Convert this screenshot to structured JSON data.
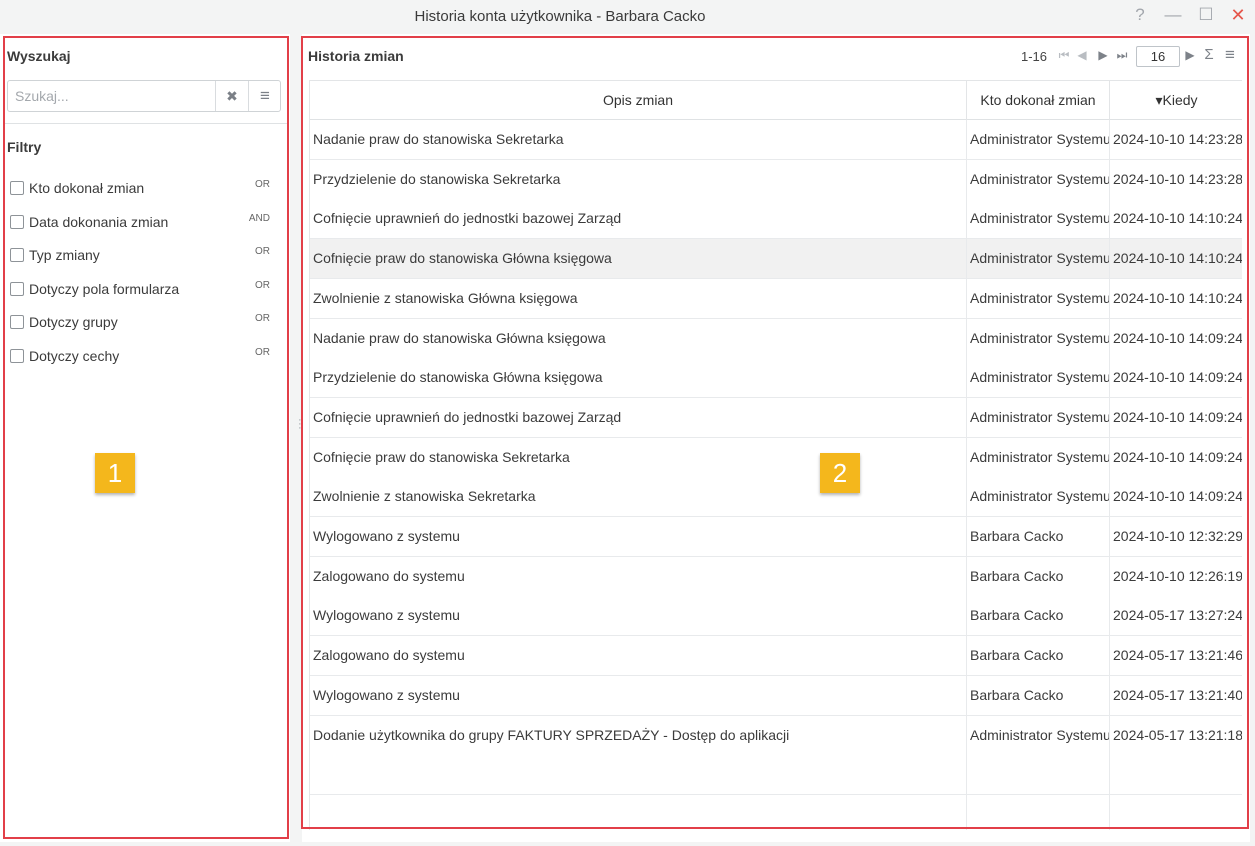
{
  "window": {
    "title": "Historia konta użytkownika - Barbara Cacko",
    "help": "?",
    "minimize": "—",
    "maximize": "☐",
    "close": "✕"
  },
  "left": {
    "search_label": "Wyszukaj",
    "search_placeholder": "Szukaj...",
    "clear_icon": "✖",
    "menu_icon": "≡",
    "filters_label": "Filtry",
    "filters": [
      {
        "label": "Kto dokonał zmian",
        "op": "OR"
      },
      {
        "label": "Data dokonania zmian",
        "op": "AND"
      },
      {
        "label": "Typ zmiany",
        "op": "OR"
      },
      {
        "label": "Dotyczy pola formularza",
        "op": "OR"
      },
      {
        "label": "Dotyczy grupy",
        "op": "OR"
      },
      {
        "label": "Dotyczy cechy",
        "op": "OR"
      }
    ],
    "badge": "1"
  },
  "right": {
    "title": "Historia zmian",
    "range": "1-16",
    "page_size": "16",
    "icons": {
      "first": "⏮",
      "prev": "◀",
      "next": "▶",
      "last": "⏭",
      "next2": "▶",
      "sum": "Σ",
      "menu": "≡"
    },
    "badge": "2",
    "columns": [
      "Opis zmian",
      "Kto dokonał zmian",
      "▾Kiedy"
    ],
    "rows": [
      [
        "Nadanie praw do stanowiska Sekretarka",
        "Administrator Systemu",
        "2024-10-10 14:23:28"
      ],
      [
        "Przydzielenie do stanowiska Sekretarka",
        "Administrator Systemu",
        "2024-10-10 14:23:28"
      ],
      [
        "Cofnięcie uprawnień do jednostki bazowej Zarząd",
        "Administrator Systemu",
        "2024-10-10 14:10:24"
      ],
      [
        "Cofnięcie praw do stanowiska Główna księgowa",
        "Administrator Systemu",
        "2024-10-10 14:10:24"
      ],
      [
        "Zwolnienie z stanowiska Główna księgowa",
        "Administrator Systemu",
        "2024-10-10 14:10:24"
      ],
      [
        "Nadanie praw do stanowiska Główna księgowa",
        "Administrator Systemu",
        "2024-10-10 14:09:24"
      ],
      [
        "Przydzielenie do stanowiska Główna księgowa",
        "Administrator Systemu",
        "2024-10-10 14:09:24"
      ],
      [
        "Cofnięcie uprawnień do jednostki bazowej Zarząd",
        "Administrator Systemu",
        "2024-10-10 14:09:24"
      ],
      [
        "Cofnięcie praw do stanowiska Sekretarka",
        "Administrator Systemu",
        "2024-10-10 14:09:24"
      ],
      [
        "Zwolnienie z stanowiska Sekretarka",
        "Administrator Systemu",
        "2024-10-10 14:09:24"
      ],
      [
        "Wylogowano z systemu",
        "Barbara Cacko",
        "2024-10-10 12:32:29"
      ],
      [
        "Zalogowano do systemu",
        "Barbara Cacko",
        "2024-10-10 12:26:19"
      ],
      [
        "Wylogowano z systemu",
        "Barbara Cacko",
        "2024-05-17 13:27:24"
      ],
      [
        "Zalogowano do systemu",
        "Barbara Cacko",
        "2024-05-17 13:21:46"
      ],
      [
        "Wylogowano z systemu",
        "Barbara Cacko",
        "2024-05-17 13:21:40"
      ],
      [
        "Dodanie użytkownika do grupy FAKTURY SPRZEDAŻY - Dostęp do aplikacji",
        "Administrator Systemu",
        "2024-05-17 13:21:18"
      ]
    ]
  }
}
